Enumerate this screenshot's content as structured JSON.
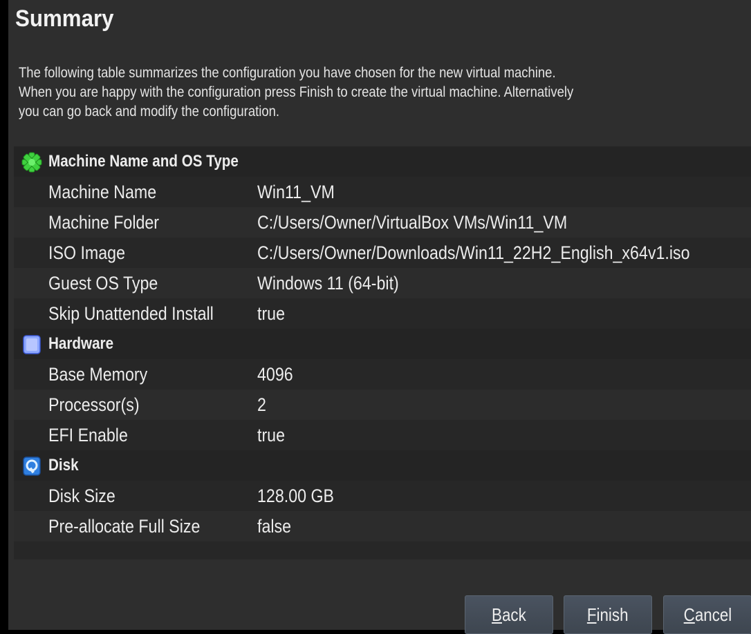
{
  "page": {
    "title": "Summary",
    "description": [
      "The following table summarizes the configuration you have chosen for the new virtual machine.",
      "When you are happy with the configuration press Finish to create the virtual machine. Alternatively",
      "you can go back and modify the configuration."
    ]
  },
  "sections": [
    {
      "icon": "machine-name-os-type-icon",
      "title": "Machine Name and OS Type",
      "rows": [
        {
          "key": "Machine Name",
          "value": "Win11_VM"
        },
        {
          "key": "Machine Folder",
          "value": "C:/Users/Owner/VirtualBox VMs/Win11_VM"
        },
        {
          "key": "ISO Image",
          "value": "C:/Users/Owner/Downloads/Win11_22H2_English_x64v1.iso"
        },
        {
          "key": "Guest OS Type",
          "value": "Windows 11 (64-bit)"
        },
        {
          "key": "Skip Unattended Install",
          "value": "true"
        }
      ]
    },
    {
      "icon": "hardware-chip-icon",
      "title": "Hardware",
      "rows": [
        {
          "key": "Base Memory",
          "value": "4096"
        },
        {
          "key": "Processor(s)",
          "value": "2"
        },
        {
          "key": "EFI Enable",
          "value": "true"
        }
      ]
    },
    {
      "icon": "disk-icon",
      "title": "Disk",
      "rows": [
        {
          "key": "Disk Size",
          "value": "128.00 GB"
        },
        {
          "key": "Pre-allocate Full Size",
          "value": "false"
        }
      ]
    }
  ],
  "buttons": {
    "back": {
      "mnemonic": "B",
      "rest": "ack"
    },
    "finish": {
      "mnemonic": "F",
      "rest": "inish"
    },
    "cancel": {
      "mnemonic": "C",
      "rest": "ancel"
    }
  },
  "colors": {
    "background": "#2e2e2e",
    "table_background": "#272727",
    "button": "#444c57",
    "text": "#ececec"
  }
}
